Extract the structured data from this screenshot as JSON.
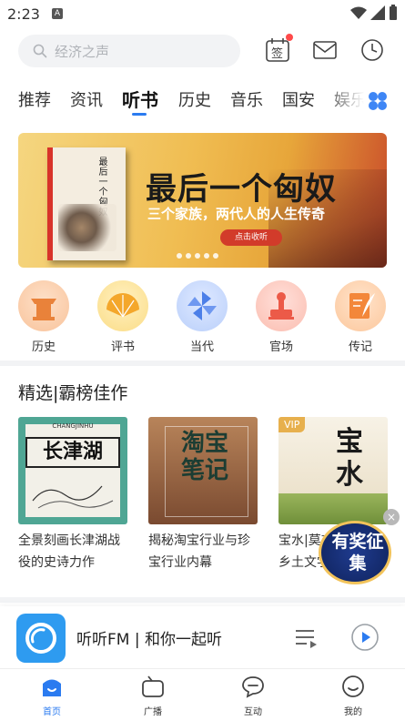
{
  "status_bar": {
    "time": "2:23",
    "notice_badge": "A"
  },
  "search": {
    "placeholder": "经济之声"
  },
  "top_icons": {
    "sign_label": "签"
  },
  "tabs": [
    {
      "label": "推荐",
      "active": false
    },
    {
      "label": "资讯",
      "active": false
    },
    {
      "label": "听书",
      "active": true
    },
    {
      "label": "历史",
      "active": false
    },
    {
      "label": "音乐",
      "active": false
    },
    {
      "label": "国安",
      "active": false
    },
    {
      "label": "娱乐",
      "active": false
    }
  ],
  "banner": {
    "book_title": "最后一个匈奴",
    "title": "最后一个匈奴",
    "subtitle": "三个家族，两代人的人生传奇",
    "button": "点击收听",
    "dot_count": 5
  },
  "categories": [
    {
      "label": "历史",
      "icon": "temple-icon",
      "color": "#f4a05a"
    },
    {
      "label": "评书",
      "icon": "fan-icon",
      "color": "#f5b93a"
    },
    {
      "label": "当代",
      "icon": "pinwheel-icon",
      "color": "#5b8ef0"
    },
    {
      "label": "官场",
      "icon": "seal-icon",
      "color": "#f06a5a"
    },
    {
      "label": "传记",
      "icon": "quill-icon",
      "color": "#f5914a"
    }
  ],
  "picks": {
    "title": "精选|霸榜佳作",
    "books": [
      {
        "cover_title": "长津湖",
        "cover_sub": "CHANGJINHU",
        "title": "全景刻画长津湖战役的史诗力作"
      },
      {
        "cover_title": "淘宝笔记",
        "cover_sub": "",
        "title": "揭秘淘宝行业与珍宝行业内幕"
      },
      {
        "cover_title": "宝水",
        "cover_sub": "VIP",
        "title": "宝水|莫言推荐的乡土文学"
      }
    ]
  },
  "award": {
    "text": "有奖征集",
    "close": "×"
  },
  "player": {
    "title": "听听FM | 和你一起听"
  },
  "bottom_nav": [
    {
      "label": "首页",
      "icon": "home-icon",
      "active": true
    },
    {
      "label": "广播",
      "icon": "radio-icon",
      "active": false
    },
    {
      "label": "互动",
      "icon": "chat-icon",
      "active": false
    },
    {
      "label": "我的",
      "icon": "profile-icon",
      "active": false
    }
  ],
  "colors": {
    "accent": "#2b7bf0",
    "badge": "#ff4a4a",
    "search_bg": "#f2f3f5"
  }
}
